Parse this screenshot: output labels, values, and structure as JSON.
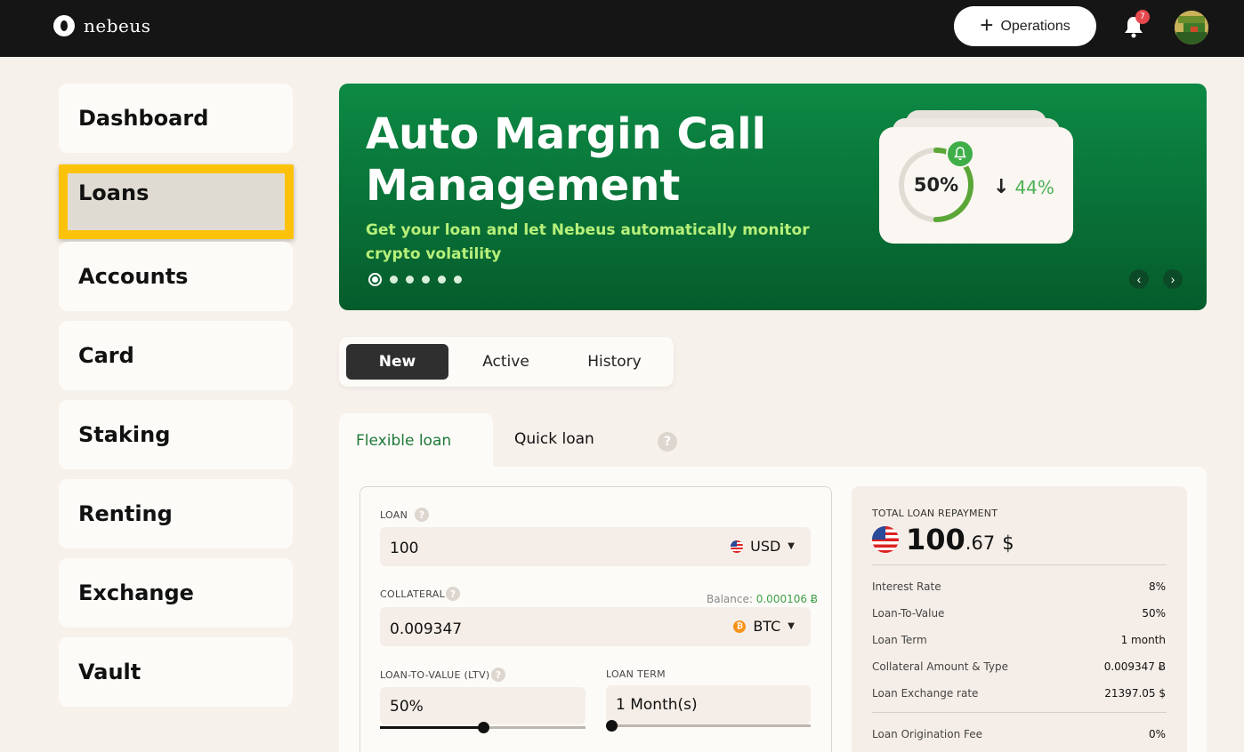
{
  "header": {
    "brand": "nebeus",
    "operations_label": "Operations",
    "notification_count": "7"
  },
  "sidebar": {
    "items": [
      {
        "label": "Dashboard"
      },
      {
        "label": "Loans"
      },
      {
        "label": "Accounts"
      },
      {
        "label": "Card"
      },
      {
        "label": "Staking"
      },
      {
        "label": "Renting"
      },
      {
        "label": "Exchange"
      },
      {
        "label": "Vault"
      }
    ],
    "active": "Loans"
  },
  "banner": {
    "title": "Auto Margin Call Management",
    "subtitle": "Get your loan and let Nebeus automatically monitor crypto volatility",
    "gauge_label": "50%",
    "gauge_fraction": 0.5,
    "change_label": "44%",
    "slide_count": 6,
    "active_slide": 1
  },
  "tabs": {
    "items": [
      "New",
      "Active",
      "History"
    ],
    "selected": "New"
  },
  "loan_types": {
    "flexible": "Flexible loan",
    "quick": "Quick loan",
    "help": "?"
  },
  "form": {
    "loan_label": "LOAN",
    "loan_value": "100",
    "loan_currency": "USD",
    "collateral_label": "COLLATERAL",
    "balance_label": "Balance:",
    "balance_value": "0.000106 Ƀ",
    "collateral_value": "0.009347",
    "collateral_currency": "BTC",
    "ltv_label": "LOAN-TO-VALUE (LTV)",
    "ltv_value": "50%",
    "ltv_slider_fraction": 0.5,
    "term_label": "LOAN TERM",
    "term_value": "1 Month(s)",
    "term_slider_fraction": 0.0,
    "help": "?"
  },
  "summary": {
    "title": "TOTAL LOAN REPAYMENT",
    "amount_int": "100",
    "amount_dec": ".67",
    "amount_symbol": "$",
    "rows": [
      {
        "label": "Interest Rate",
        "value": "8%"
      },
      {
        "label": "Loan-To-Value",
        "value": "50%"
      },
      {
        "label": "Loan Term",
        "value": "1 month"
      },
      {
        "label": "Collateral Amount & Type",
        "value": "0.009347 Ƀ"
      },
      {
        "label": "Loan Exchange rate",
        "value": "21397.05 $"
      },
      {
        "label": "Loan Origination Fee",
        "value": "0%"
      }
    ]
  },
  "colors": {
    "accent_green": "#0d8a44",
    "highlight_yellow": "#fcc20a",
    "badge_red": "#e5484d"
  }
}
